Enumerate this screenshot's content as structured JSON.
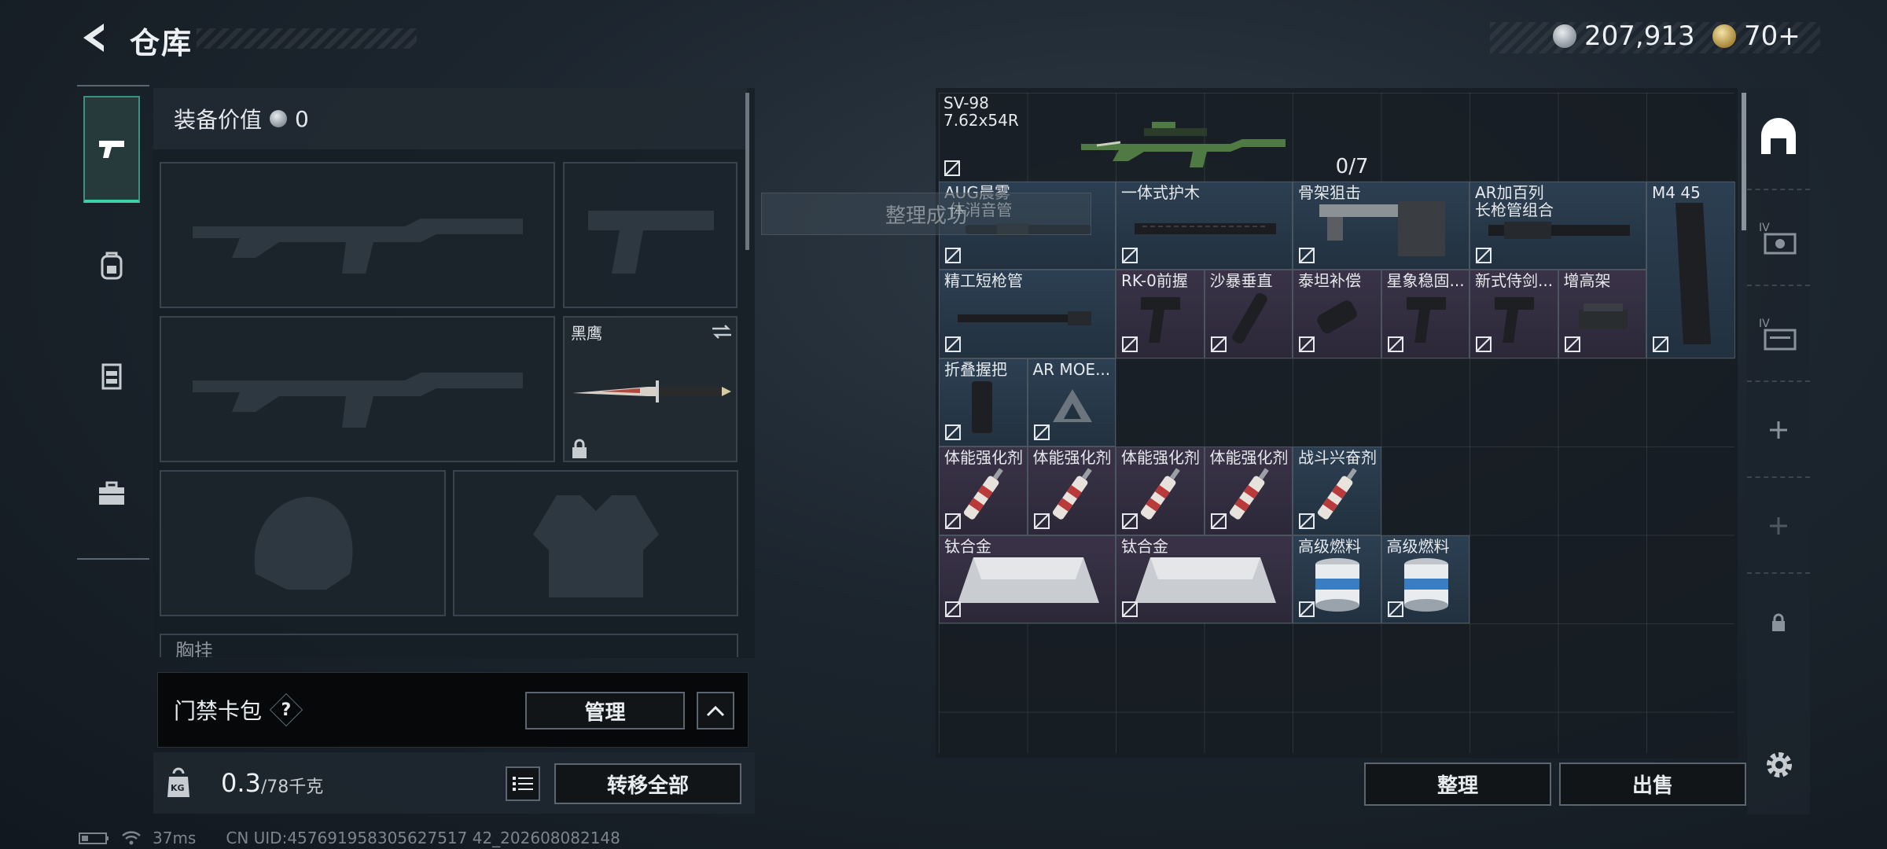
{
  "header": {
    "title": "仓库"
  },
  "currency": {
    "coins": "207,913",
    "tickets": "70+"
  },
  "left_tabs": [
    {
      "name": "weapons-tab",
      "icon": "pistol-icon",
      "active": true
    },
    {
      "name": "backpack-tab",
      "icon": "backpack-icon",
      "active": false
    },
    {
      "name": "vest-tab",
      "icon": "vest-icon",
      "active": false
    },
    {
      "name": "case-tab",
      "icon": "briefcase-icon",
      "active": false
    }
  ],
  "equipment": {
    "value_label": "装备价值",
    "value": "0",
    "melee_name": "黑鹰",
    "chest_label": "胸挂"
  },
  "keycard": {
    "label": "门禁卡包",
    "help": "?",
    "manage_label": "管理"
  },
  "weight": {
    "current": "0.3",
    "max": "/78千克",
    "unit_badge": "KG",
    "transfer_label": "转移全部"
  },
  "toast": "整理成功",
  "grid_items": [
    {
      "name": "SV-98\n7.62x54R",
      "count": "0/7"
    },
    {
      "name": "AUG晨雾\n 体消音管"
    },
    {
      "name": "一体式护木"
    },
    {
      "name": "骨架狙击"
    },
    {
      "name": "AR加百列\n长枪管组合"
    },
    {
      "name": "M4 45"
    },
    {
      "name": "精工短枪管"
    },
    {
      "name": "RK-0前握"
    },
    {
      "name": "沙暴垂直"
    },
    {
      "name": "泰坦补偿"
    },
    {
      "name": "星象稳固..."
    },
    {
      "name": "新式侍剑..."
    },
    {
      "name": "增高架"
    },
    {
      "name": "折叠握把"
    },
    {
      "name": "AR MOE..."
    },
    {
      "name": "体能强化剂"
    },
    {
      "name": "体能强化剂"
    },
    {
      "name": "体能强化剂"
    },
    {
      "name": "体能强化剂"
    },
    {
      "name": "战斗兴奋剂"
    },
    {
      "name": "钛合金"
    },
    {
      "name": "钛合金"
    },
    {
      "name": "高级燃料"
    },
    {
      "name": "高级燃料"
    }
  ],
  "actions": {
    "sort_label": "整理",
    "sell_label": "出售"
  },
  "status": {
    "ping": "37ms",
    "uid": "CN UID:457691958305627517 42_202608082148"
  }
}
